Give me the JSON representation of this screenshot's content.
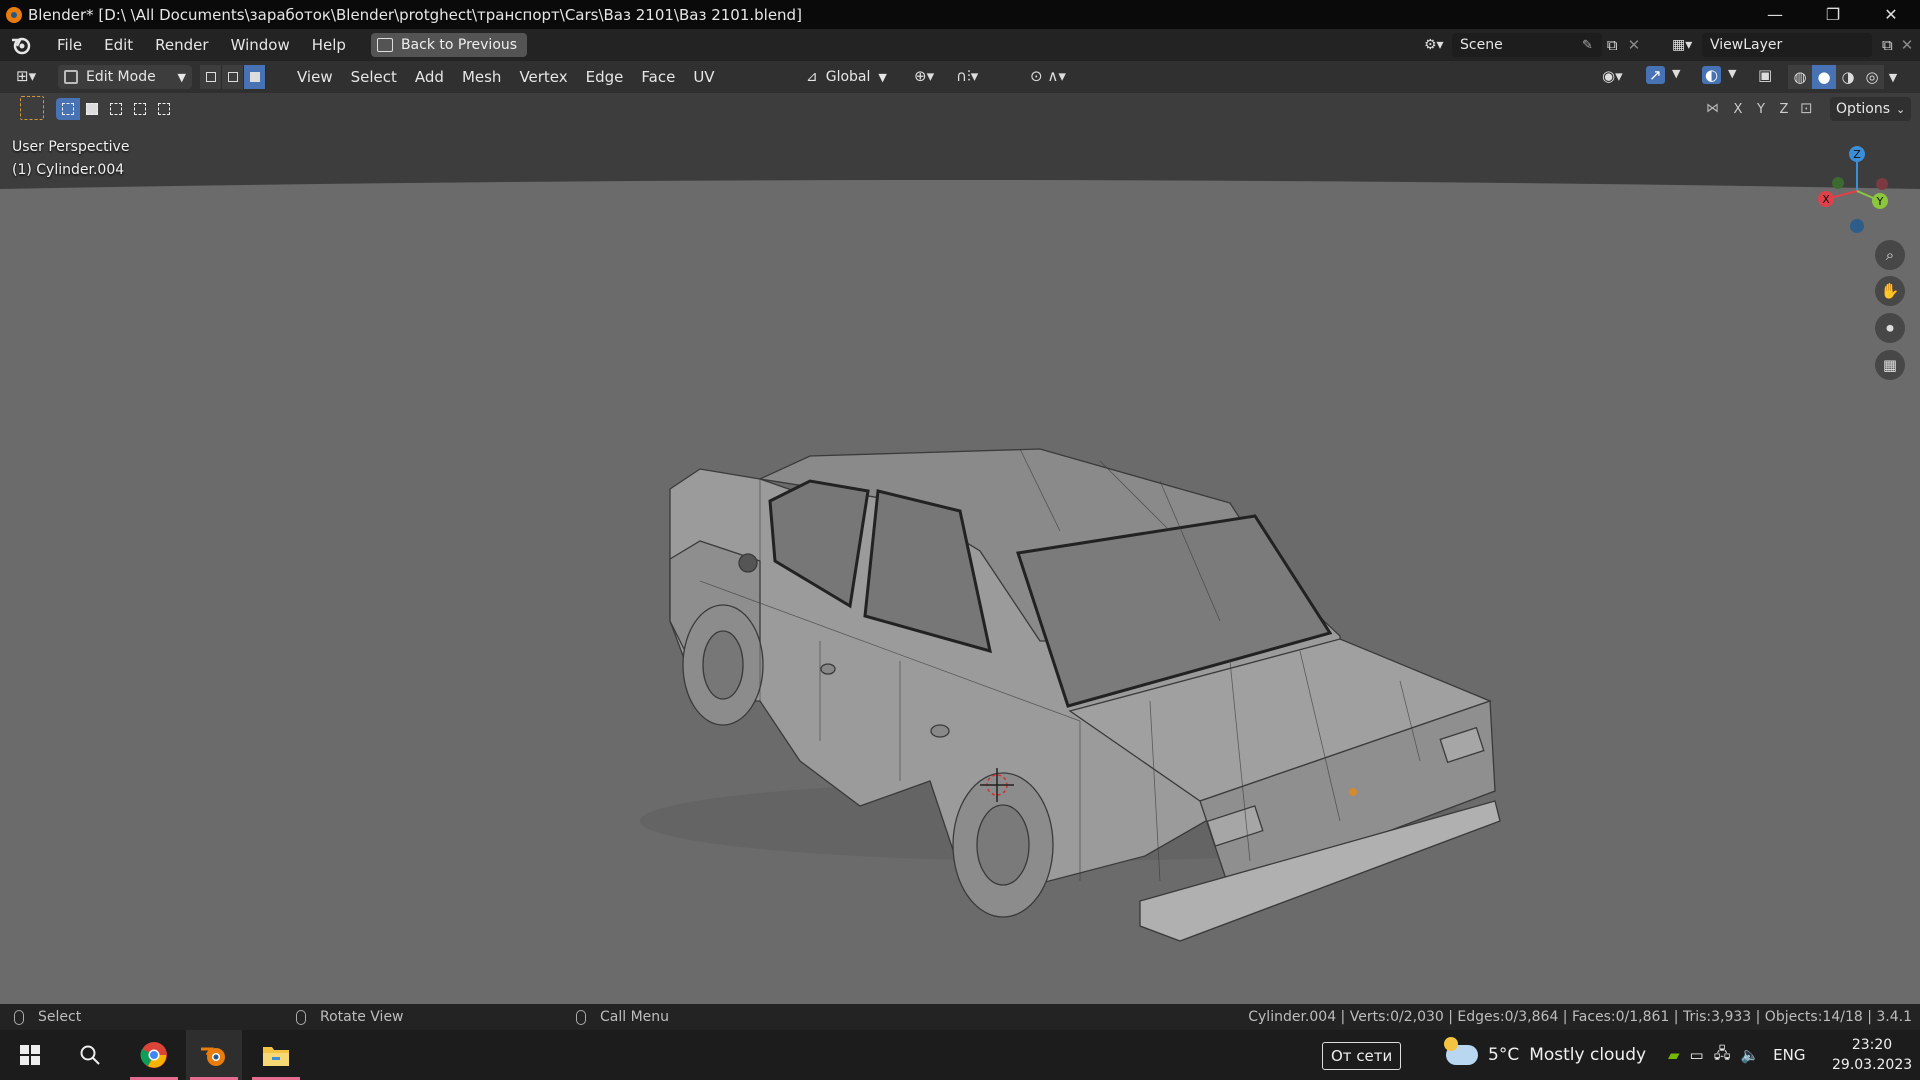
{
  "window": {
    "title": "Blender* [D:\\ \\All Documents\\заработок\\Blender\\protghect\\транспорт\\Cars\\Ваз 2101\\Ваз 2101.blend]",
    "minimize": "—",
    "maximize": "❐",
    "close": "✕"
  },
  "topbar": {
    "menus": [
      "File",
      "Edit",
      "Render",
      "Window",
      "Help"
    ],
    "back_label": "Back to Previous",
    "scene_label": "Scene",
    "viewlayer_label": "ViewLayer"
  },
  "header": {
    "mode_label": "Edit Mode",
    "menus": [
      "View",
      "Select",
      "Add",
      "Mesh",
      "Vertex",
      "Edge",
      "Face",
      "UV"
    ],
    "orientation_label": "Global",
    "axes": [
      "X",
      "Y",
      "Z"
    ],
    "options_label": "Options"
  },
  "viewport": {
    "perspective_label": "User Perspective",
    "object_label": "(1) Cylinder.004",
    "gizmo_axes": {
      "x": "X",
      "y": "Y",
      "z": "Z"
    },
    "background_color": "#6a6a6a"
  },
  "statusbar": {
    "left_action": "Select",
    "middle_action": "Rotate View",
    "right_action": "Call Menu",
    "stats": "Cylinder.004 | Verts:0/2,030 | Edges:0/3,864 | Faces:0/1,861 | Tris:3,933 | Objects:14/18 | 3.4.1"
  },
  "taskbar": {
    "network_label": "От сети",
    "weather_temp": "5°C",
    "weather_text": "Mostly cloudy",
    "language": "ENG",
    "time": "23:20",
    "date": "29.03.2023"
  },
  "colors": {
    "accent_blue": "#4772b3",
    "axis_x": "#e0404a",
    "axis_y": "#8bc63d",
    "axis_z": "#3b8fd8",
    "blender_orange": "#e87d0d"
  }
}
